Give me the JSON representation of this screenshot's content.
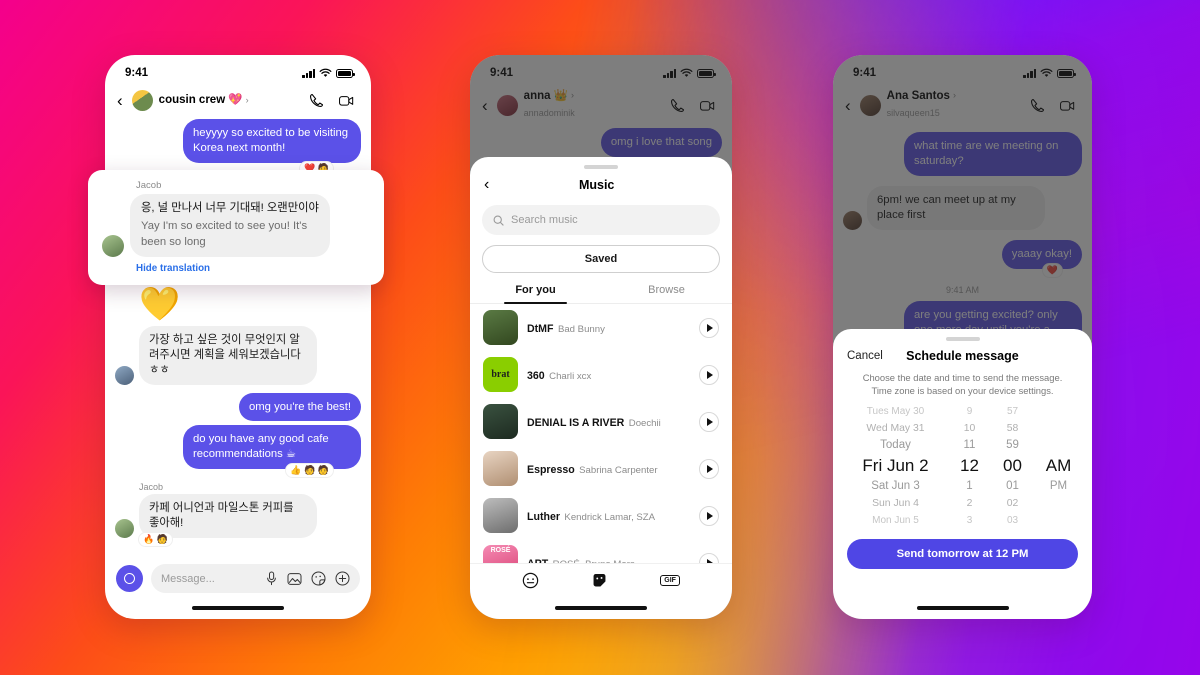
{
  "background": {
    "description": "Instagram brand gradient",
    "colors": [
      "#F4008C",
      "#FF3B30",
      "#FF7A00",
      "#FFC800",
      "#7B2BFF",
      "#C800E0"
    ]
  },
  "phone1": {
    "status": {
      "time": "9:41",
      "signal_icon": "cellular-bars-icon",
      "wifi_icon": "wifi-icon",
      "battery_icon": "battery-icon"
    },
    "header": {
      "back_icon": "back-chevron-icon",
      "title": "cousin crew 💖",
      "chevron": "›",
      "call_icon": "phone-call-icon",
      "video_icon": "video-call-icon"
    },
    "messages": [
      {
        "id": "m1",
        "dir": "out",
        "text": "heyyyy so excited to be visiting Korea next month!",
        "reactions": "❤️ 🧑"
      },
      {
        "id": "m2",
        "sender": "Jacob",
        "dir": "in",
        "emoji": "💛"
      },
      {
        "id": "m3",
        "dir": "in",
        "text": "가장 하고 싶은 것이 무엇인지 알려주시면 계획을 세워보겠습니다 ㅎㅎ"
      },
      {
        "id": "m4",
        "dir": "out",
        "text": "omg you're the best!"
      },
      {
        "id": "m5",
        "dir": "out",
        "text": "do you have any good cafe recommendations ☕",
        "reactions": "👍 🧑 🧑"
      },
      {
        "id": "m6",
        "sender": "Jacob",
        "dir": "in",
        "text": "카페 어니언과 마일스톤 커피를 좋아해!",
        "reactions": "🔥 🧑"
      }
    ],
    "composer": {
      "camera_icon": "camera-icon",
      "placeholder": "Message...",
      "mic_icon": "microphone-icon",
      "gallery_icon": "photo-gallery-icon",
      "sticker_icon": "sticker-icon",
      "plus_icon": "plus-circle-icon"
    }
  },
  "translation_card": {
    "sender": "Jacob",
    "original": "응, 널 만나서 너무 기대돼! 오랜만이야",
    "translated": "Yay I'm so excited to see you! It's been so long",
    "hide_label": "Hide translation",
    "link_color": "#2a6fe8"
  },
  "phone2": {
    "status": {
      "time": "9:41"
    },
    "header": {
      "back_icon": "back-chevron-icon",
      "title": "anna 👑",
      "chevron": "›",
      "subtitle": "annadominik",
      "call_icon": "phone-call-icon",
      "video_icon": "video-call-icon"
    },
    "background_message": "omg i love that song",
    "sheet": {
      "back_icon": "back-chevron-icon",
      "title": "Music",
      "search_placeholder": "Search music",
      "search_icon": "search-icon",
      "saved_label": "Saved",
      "tabs": [
        {
          "label": "For you",
          "active": true
        },
        {
          "label": "Browse",
          "active": false
        }
      ],
      "songs": [
        {
          "title": "DtMF",
          "artist": "Bad Bunny",
          "art_color": "#4a6b3a",
          "art_text": ""
        },
        {
          "title": "360",
          "artist": "Charli xcx",
          "art_color": "#8ACE00",
          "art_text": "brat"
        },
        {
          "title": "DENIAL IS A RIVER",
          "artist": "Doechii",
          "art_color": "#2d4233",
          "art_text": ""
        },
        {
          "title": "Espresso",
          "artist": "Sabrina Carpenter",
          "art_color": "#d9c2b0",
          "art_text": ""
        },
        {
          "title": "Luther",
          "artist": "Kendrick Lamar, SZA",
          "art_color": "#9a9a9a",
          "art_text": ""
        },
        {
          "title": "APT",
          "artist": "ROSÉ, Bruno Mars",
          "art_color": "#f06fa0",
          "art_text": "ROSÉ"
        }
      ],
      "play_icon": "play-button-icon",
      "tabbar": [
        {
          "icon": "emoji-face-icon"
        },
        {
          "icon": "sticker-icon"
        },
        {
          "icon": "gif-icon",
          "label": "GIF"
        }
      ]
    }
  },
  "phone3": {
    "status": {
      "time": "9:41"
    },
    "header": {
      "back_icon": "back-chevron-icon",
      "title": "Ana Santos",
      "chevron": "›",
      "subtitle": "silvaqueen15",
      "call_icon": "phone-call-icon",
      "video_icon": "video-call-icon"
    },
    "messages": [
      {
        "dir": "out",
        "text": "what time are we meeting on saturday?"
      },
      {
        "dir": "in",
        "text": "6pm! we can meet up at my place first"
      },
      {
        "dir": "out",
        "text": "yaaay okay!",
        "reactions": "❤️"
      },
      {
        "timestamp": "9:41 AM"
      },
      {
        "dir": "out",
        "text": "are you getting excited? only one more day until you're a year older"
      }
    ],
    "sheet": {
      "cancel_label": "Cancel",
      "title": "Schedule message",
      "description": "Choose the date and time to send the message. Time zone is based on your device settings.",
      "picker": {
        "date_column": [
          "Tues May 30",
          "Wed May 31",
          "Today",
          "Fri Jun 2",
          "Sat Jun 3",
          "Sun Jun 4",
          "Mon Jun 5"
        ],
        "hour_column": [
          "9",
          "10",
          "11",
          "12",
          "1",
          "2",
          "3"
        ],
        "minute_column": [
          "57",
          "58",
          "59",
          "00",
          "01",
          "02",
          "03"
        ],
        "ampm_column": [
          "",
          "",
          "",
          "AM",
          "PM",
          "",
          ""
        ],
        "selected_index": 3,
        "selected_date": "Fri Jun 2",
        "selected_hour": "12",
        "selected_minute": "00",
        "selected_ampm": "AM"
      },
      "send_label": "Send tomorrow at 12 PM",
      "send_color": "#4F46E5"
    }
  }
}
